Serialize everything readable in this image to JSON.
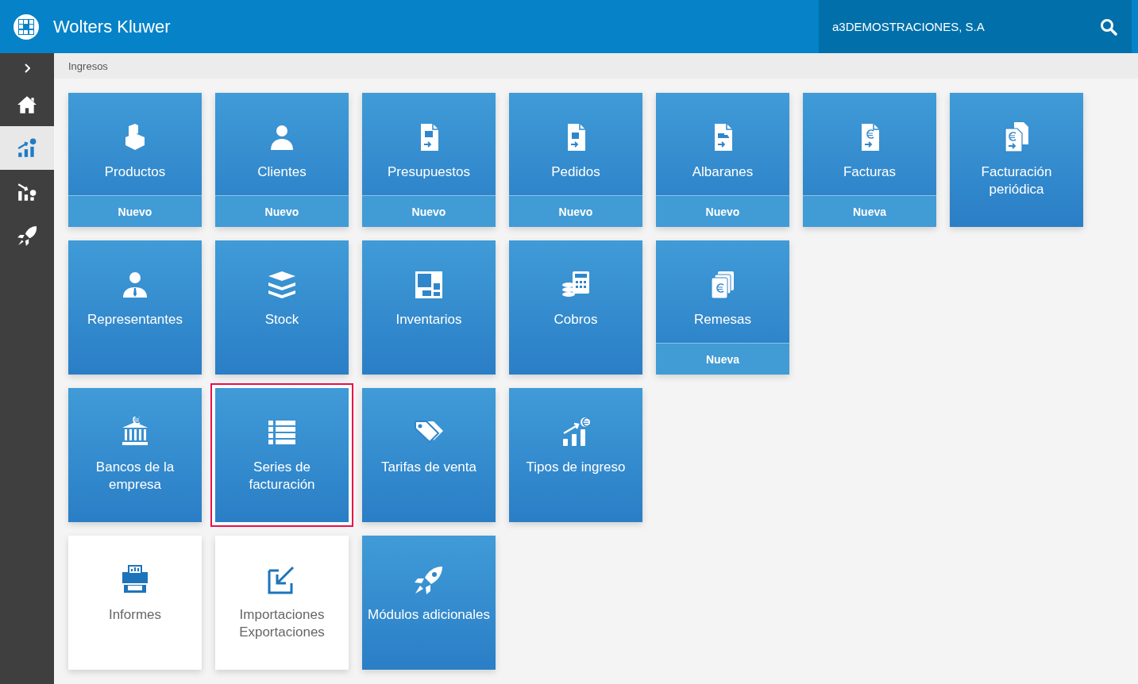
{
  "header": {
    "brand": "Wolters Kluwer",
    "company": "a3DEMOSTRACIONES, S.A"
  },
  "sidebar": {
    "items": [
      {
        "selected": false
      },
      {
        "selected": true
      },
      {
        "selected": false
      },
      {
        "selected": false
      }
    ]
  },
  "breadcrumb": "Ingresos",
  "tile_rows": [
    [
      {
        "kind": "blue",
        "label": "Productos",
        "action": "Nuevo",
        "selected": false
      },
      {
        "kind": "blue",
        "label": "Clientes",
        "action": "Nuevo",
        "selected": false
      },
      {
        "kind": "blue",
        "label": "Presupuestos",
        "action": "Nuevo",
        "selected": false
      },
      {
        "kind": "blue",
        "label": "Pedidos",
        "action": "Nuevo",
        "selected": false
      },
      {
        "kind": "blue",
        "label": "Albaranes",
        "action": "Nuevo",
        "selected": false
      },
      {
        "kind": "blue",
        "label": "Facturas",
        "action": "Nueva",
        "selected": false
      },
      {
        "kind": "blue",
        "label": "Facturación periódica",
        "selected": false
      }
    ],
    [
      {
        "kind": "blue",
        "label": "Representantes",
        "selected": false
      },
      {
        "kind": "blue",
        "label": "Stock",
        "selected": false
      },
      {
        "kind": "blue",
        "label": "Inventarios",
        "selected": false
      },
      {
        "kind": "blue",
        "label": "Cobros",
        "selected": false
      },
      {
        "kind": "blue",
        "label": "Remesas",
        "action": "Nueva",
        "selected": false
      }
    ],
    [
      {
        "kind": "blue",
        "label": "Bancos de la empresa",
        "selected": false
      },
      {
        "kind": "blue",
        "label": "Series de facturación",
        "selected": true
      },
      {
        "kind": "blue",
        "label": "Tarifas de venta",
        "selected": false
      },
      {
        "kind": "blue",
        "label": "Tipos de ingreso",
        "selected": false
      }
    ],
    [
      {
        "kind": "white",
        "label": "Informes",
        "selected": false
      },
      {
        "kind": "white",
        "label": "Importaciones Exportaciones",
        "selected": false
      },
      {
        "kind": "blue",
        "label": "Módulos adicionales",
        "selected": false
      }
    ]
  ]
}
